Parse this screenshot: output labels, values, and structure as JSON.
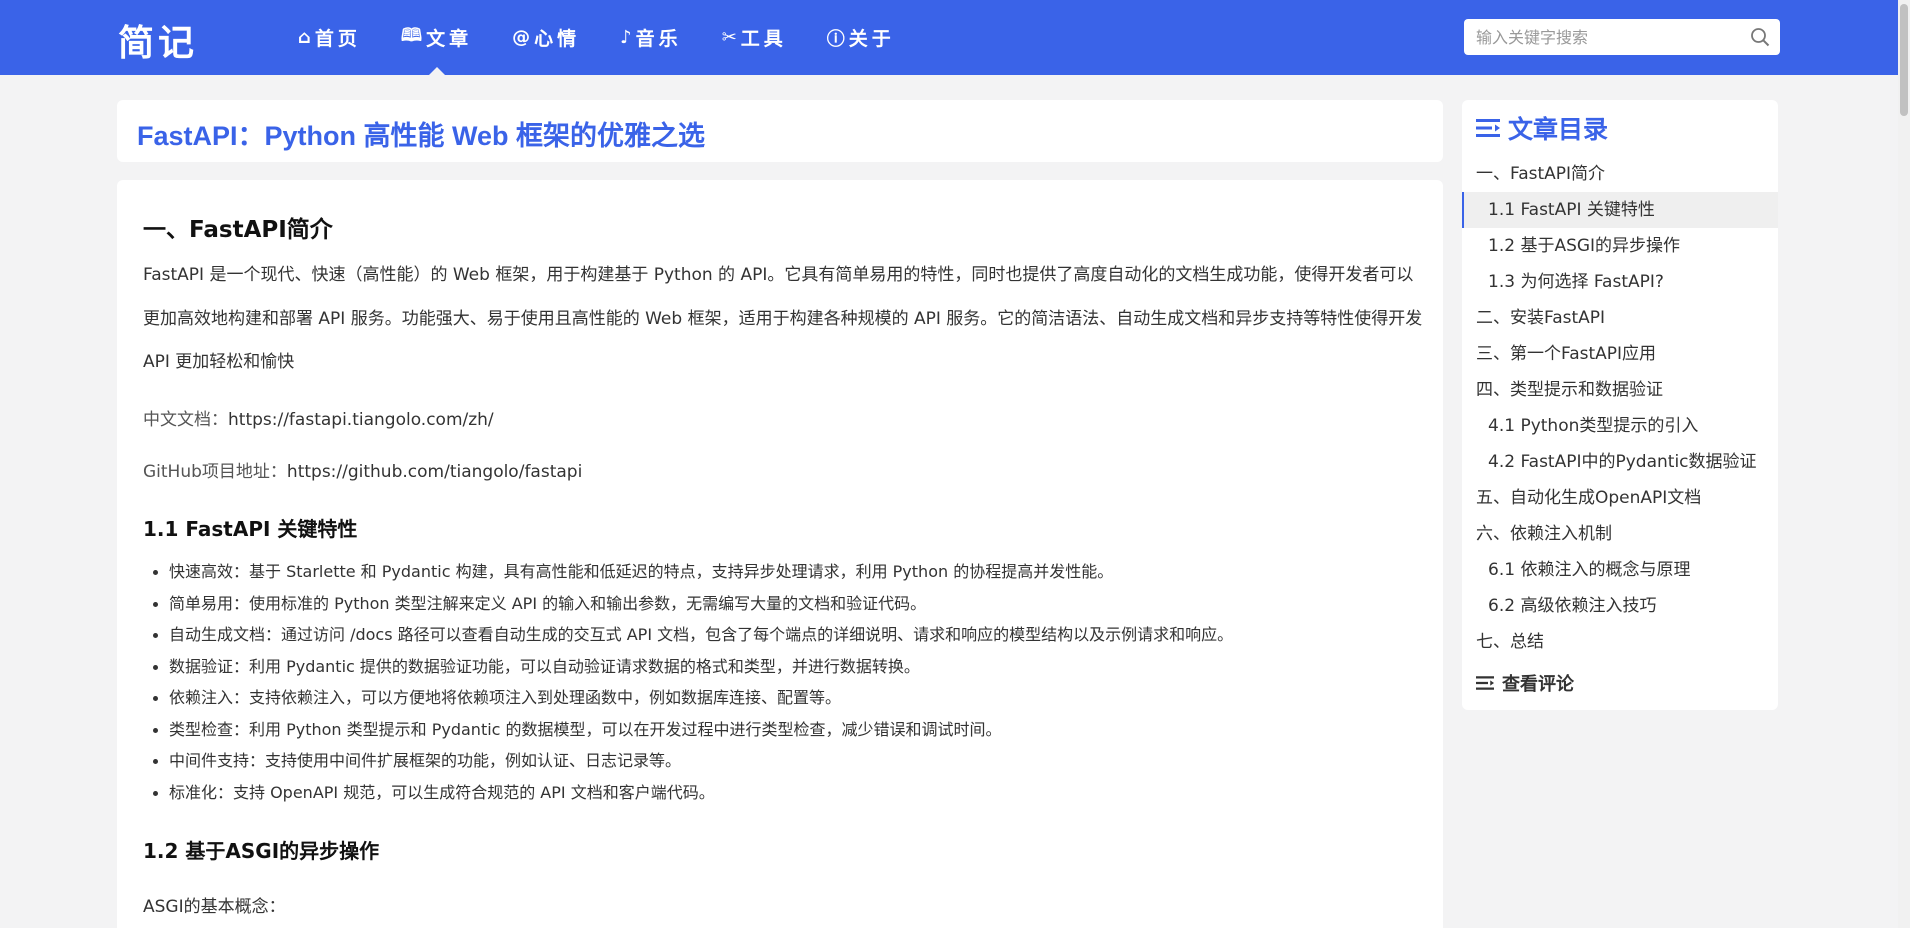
{
  "header": {
    "logo": "简记",
    "nav": [
      {
        "icon": "⌂",
        "icon_name": "home-icon",
        "label": "首页"
      },
      {
        "icon": "🕮",
        "icon_name": "book-icon",
        "label": "文章"
      },
      {
        "icon": "@",
        "icon_name": "at-icon",
        "label": "心情"
      },
      {
        "icon": "♪",
        "icon_name": "music-note-icon",
        "label": "音乐"
      },
      {
        "icon": "✂",
        "icon_name": "tools-icon",
        "label": "工具"
      },
      {
        "icon": "ⓘ",
        "icon_name": "info-icon",
        "label": "关于"
      }
    ],
    "active_nav": "文章",
    "search": {
      "placeholder": "输入关键字搜索",
      "value": ""
    },
    "accent_color": "#3a63e8"
  },
  "article": {
    "title": "FastAPI：Python 高性能 Web 框架的优雅之选",
    "section1_heading": "一、FastAPI简介",
    "intro": "FastAPI 是一个现代、快速（高性能）的 Web 框架，用于构建基于 Python 的 API。它具有简单易用的特性，同时也提供了高度自动化的文档生成功能，使得开发者可以更加高效地构建和部署 API 服务。功能强大、易于使用且高性能的 Web 框架，适用于构建各种规模的 API 服务。它的简洁语法、自动生成文档和异步支持等特性使得开发 API 更加轻松和愉快",
    "docs": {
      "label": "中文文档：",
      "url": "https://fastapi.tiangolo.com/zh/"
    },
    "github": {
      "label": "GitHub项目地址：",
      "url": "https://github.com/tiangolo/fastapi"
    },
    "sub1_heading": "1.1 FastAPI 关键特性",
    "features": [
      "快速高效：基于 Starlette 和 Pydantic 构建，具有高性能和低延迟的特点，支持异步处理请求，利用 Python 的协程提高并发性能。",
      "简单易用：使用标准的 Python 类型注解来定义 API 的输入和输出参数，无需编写大量的文档和验证代码。",
      "自动生成文档：通过访问 /docs 路径可以查看自动生成的交互式 API 文档，包含了每个端点的详细说明、请求和响应的模型结构以及示例请求和响应。",
      "数据验证：利用 Pydantic 提供的数据验证功能，可以自动验证请求数据的格式和类型，并进行数据转换。",
      "依赖注入：支持依赖注入，可以方便地将依赖项注入到处理函数中，例如数据库连接、配置等。",
      "类型检查：利用 Python 类型提示和 Pydantic 的数据模型，可以在开发过程中进行类型检查，减少错误和调试时间。",
      "中间件支持：支持使用中间件扩展框架的功能，例如认证、日志记录等。",
      "标准化：支持 OpenAPI 规范，可以生成符合规范的 API 文档和客户端代码。"
    ],
    "sub2_heading": "1.2 基于ASGI的异步操作",
    "asgi_concept": "ASGI的基本概念："
  },
  "toc": {
    "title": "文章目录",
    "items": [
      {
        "label": "一、FastAPI简介",
        "level": 1
      },
      {
        "label": "1.1 FastAPI 关键特性",
        "level": 2,
        "active": true
      },
      {
        "label": "1.2 基于ASGI的异步操作",
        "level": 2
      },
      {
        "label": "1.3 为何选择 FastAPI?",
        "level": 2
      },
      {
        "label": "二、安装FastAPI",
        "level": 1
      },
      {
        "label": "三、第一个FastAPI应用",
        "level": 1
      },
      {
        "label": "四、类型提示和数据验证",
        "level": 1
      },
      {
        "label": "4.1 Python类型提示的引入",
        "level": 2
      },
      {
        "label": "4.2 FastAPI中的Pydantic数据验证",
        "level": 2
      },
      {
        "label": "五、自动化生成OpenAPI文档",
        "level": 1
      },
      {
        "label": "六、依赖注入机制",
        "level": 1
      },
      {
        "label": "6.1 依赖注入的概念与原理",
        "level": 2
      },
      {
        "label": "6.2 高级依赖注入技巧",
        "level": 2
      },
      {
        "label": "七、总结",
        "level": 1
      }
    ],
    "comment_label": "查看评论"
  }
}
